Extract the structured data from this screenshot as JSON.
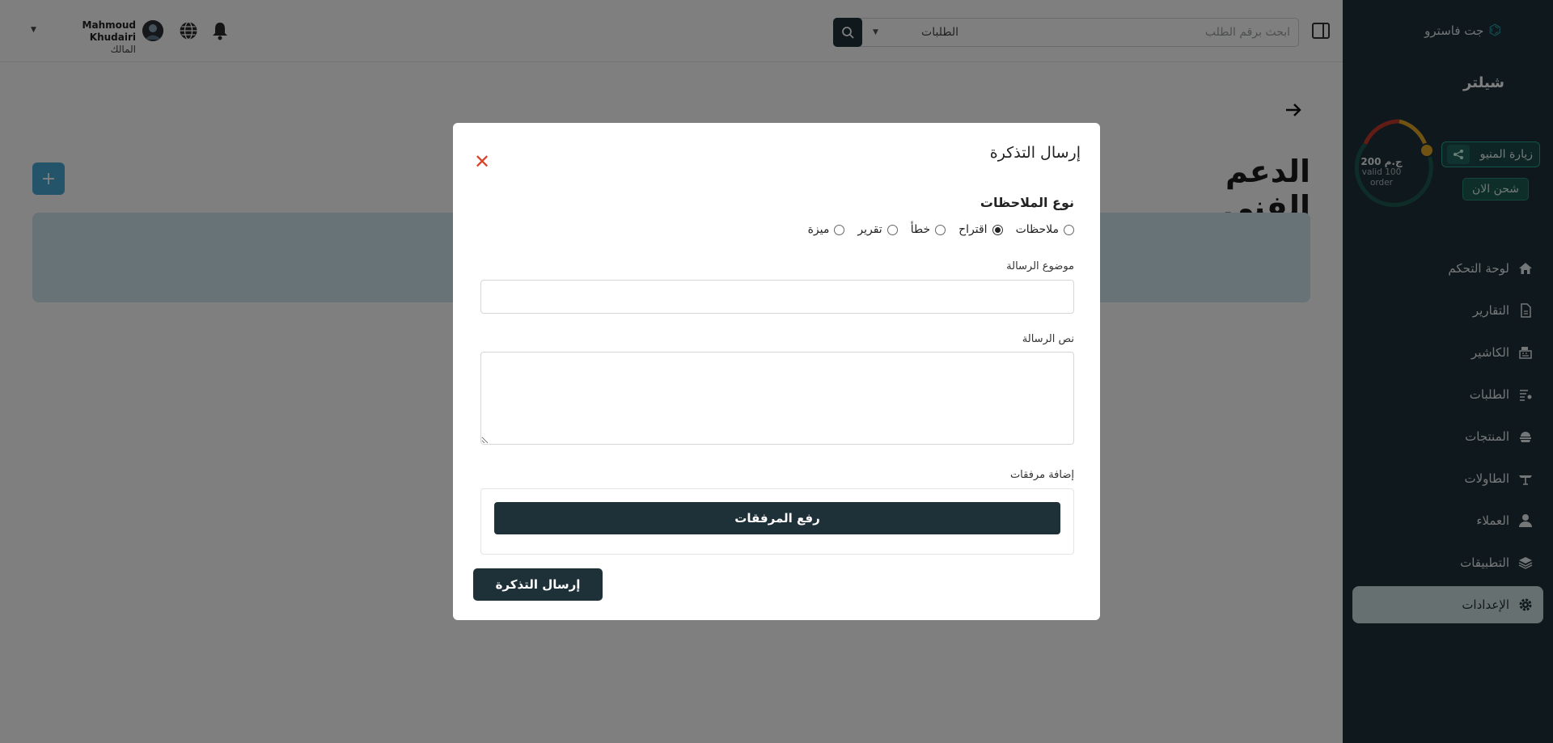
{
  "sidebar": {
    "brand": "جت فاسترو",
    "shop_name": "شيلتر",
    "balance": {
      "amount": "200 ج.م",
      "valid": "valid 100",
      "order": "order"
    },
    "visit_menu_label": "زيارة المنيو",
    "charge_label": "شحن الان",
    "nav": [
      {
        "label": "لوحة التحكم",
        "icon": "home-icon"
      },
      {
        "label": "التقارير",
        "icon": "report-icon"
      },
      {
        "label": "الكاشير",
        "icon": "cashier-icon"
      },
      {
        "label": "الطلبات",
        "icon": "orders-icon"
      },
      {
        "label": "المنتجات",
        "icon": "products-icon"
      },
      {
        "label": "الطاولات",
        "icon": "tables-icon"
      },
      {
        "label": "العملاء",
        "icon": "user-icon"
      },
      {
        "label": "التطبيقات",
        "icon": "layers-icon"
      },
      {
        "label": "الإعدادات",
        "icon": "gear-icon",
        "active": true
      }
    ]
  },
  "header": {
    "search_placeholder": "ابحث برقم الطلب",
    "search_type": "الطلبات",
    "user_name": "Mahmoud Khudairi",
    "user_role": "المالك"
  },
  "page": {
    "title": "الدعم الفني",
    "add_label": "+"
  },
  "modal": {
    "title": "إرسال التذكرة",
    "feedback_type_label": "نوع الملاحظات",
    "feedback_types": [
      "ملاحظات",
      "اقتراح",
      "خطأ",
      "تقرير",
      "ميزة"
    ],
    "selected_type": "اقتراح",
    "subject_label": "موضوع الرسالة",
    "subject_value": "",
    "body_label": "نص الرسالة",
    "body_value": "",
    "attachments_label": "إضافة مرفقات",
    "upload_label": "رفع المرفقات",
    "submit_label": "إرسال التذكرة",
    "close_label": "✕"
  },
  "colors": {
    "sidebar_bg": "#1f3138",
    "primary": "#1f3138",
    "accent_blue": "#49a8d4",
    "close_red": "#d9442b"
  }
}
